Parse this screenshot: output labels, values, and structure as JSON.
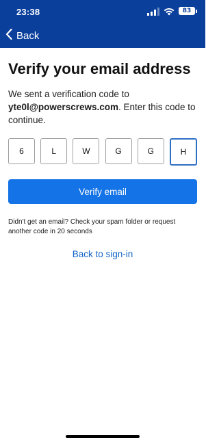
{
  "status_bar": {
    "time": "23:38",
    "battery": "83"
  },
  "nav": {
    "back_label": "Back"
  },
  "main": {
    "title": "Verify your email address",
    "description_prefix": "We sent a verification code to ",
    "email": "yte0l@powerscrews.com",
    "description_suffix": ". Enter this code to continue.",
    "code_digits": [
      "6",
      "L",
      "W",
      "G",
      "G",
      "H"
    ],
    "verify_button_label": "Verify email",
    "resend_text": "Didn't get an email? Check your spam folder or request another code in 20 seconds",
    "back_to_signin_label": "Back to sign-in"
  },
  "colors": {
    "header_bg": "#0a3f9c",
    "primary_button": "#1473e6",
    "link": "#1265c6",
    "active_box_border": "#2f6fc3"
  },
  "icons": {
    "back": "chevron-left-icon",
    "signal": "cellular-signal-icon",
    "wifi": "wifi-icon",
    "battery": "battery-icon"
  }
}
